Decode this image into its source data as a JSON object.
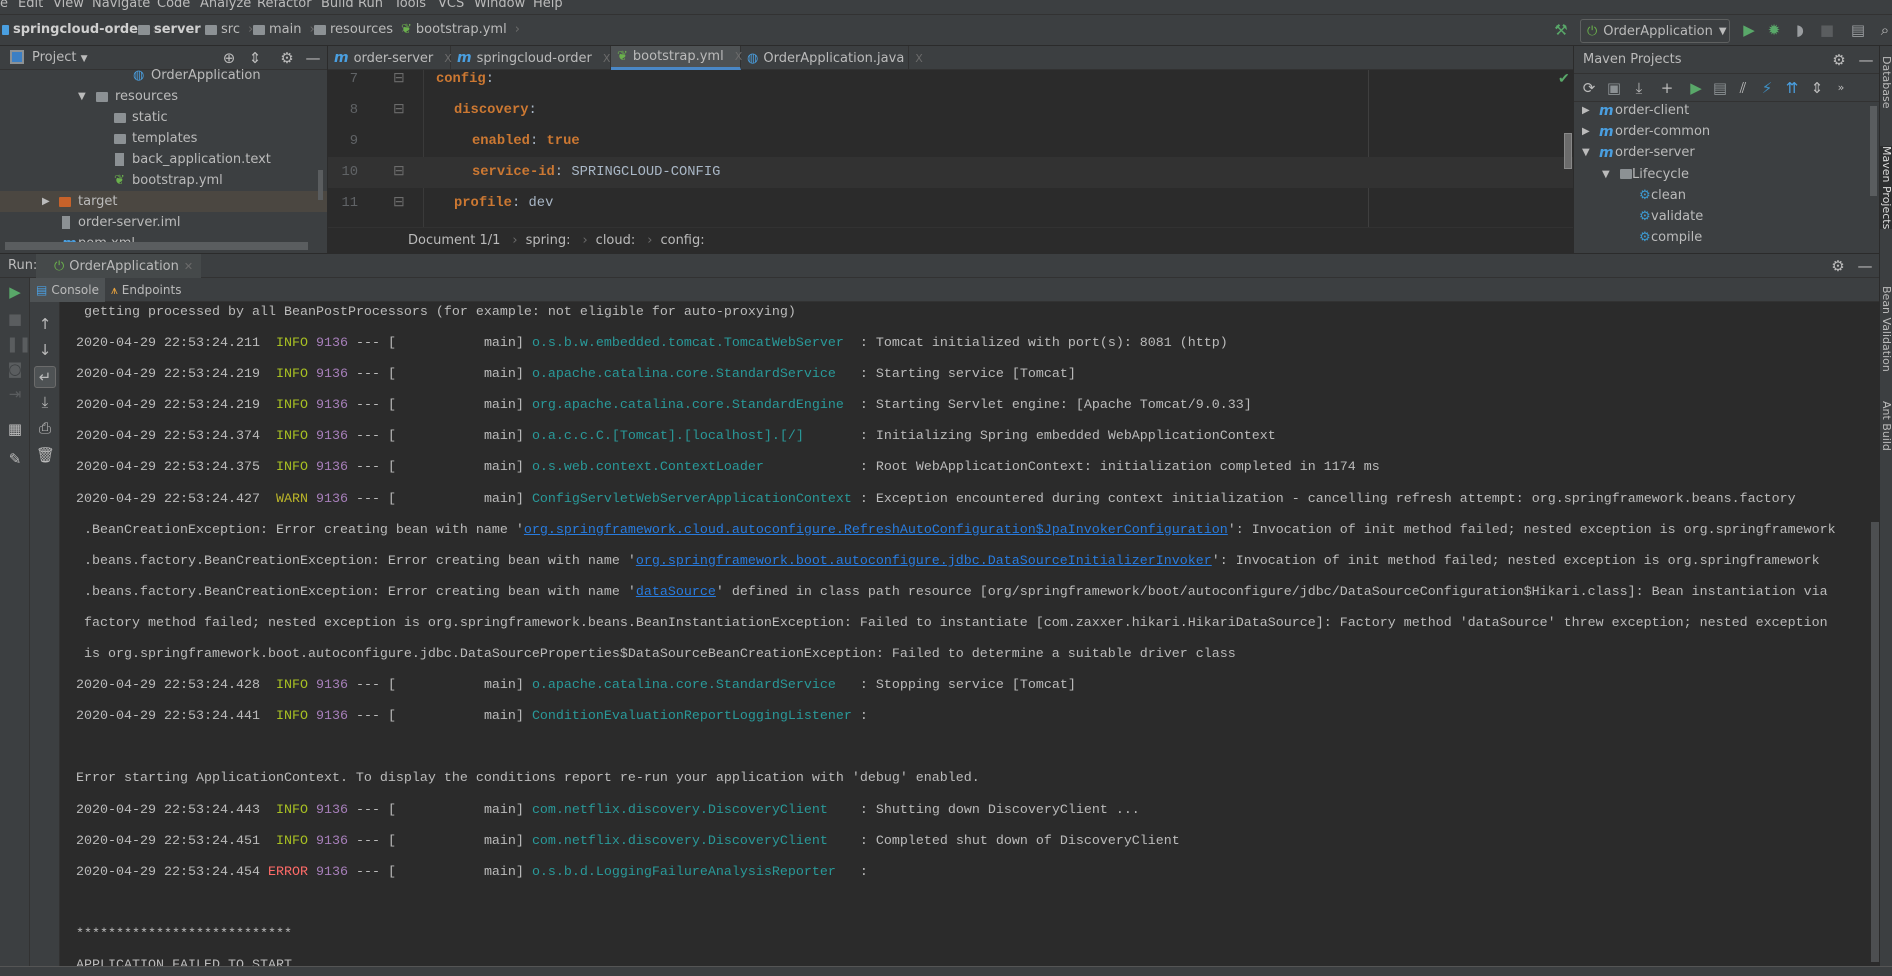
{
  "menu": [
    "e",
    "Edit",
    "View",
    "Navigate",
    "Code",
    "Analyze",
    "Refactor",
    "Build",
    "Run",
    "Tools",
    "VCS",
    "Window",
    "Help"
  ],
  "navbar": {
    "crumbs": [
      "springcloud-order",
      "server",
      "src",
      "main",
      "resources",
      "bootstrap.yml"
    ],
    "run_config": "OrderApplication"
  },
  "project": {
    "title": "Project",
    "tree": [
      {
        "label": "OrderApplication",
        "icon": "spring-boot-class-icon"
      },
      {
        "label": "resources",
        "icon": "resources-folder-icon",
        "expanded": true
      },
      {
        "label": "static",
        "icon": "folder-icon"
      },
      {
        "label": "templates",
        "icon": "folder-icon"
      },
      {
        "label": "back_application.text",
        "icon": "text-file-icon"
      },
      {
        "label": "bootstrap.yml",
        "icon": "spring-yml-icon"
      },
      {
        "label": "target",
        "icon": "excluded-folder-icon",
        "expanded": false
      },
      {
        "label": "order-server.iml",
        "icon": "iml-file-icon"
      },
      {
        "label": "pom.xml",
        "icon": "maven-icon"
      }
    ]
  },
  "editor": {
    "tabs": [
      {
        "label": "order-server",
        "icon": "maven-icon"
      },
      {
        "label": "springcloud-order",
        "icon": "maven-icon"
      },
      {
        "label": "bootstrap.yml",
        "icon": "spring-yml-icon",
        "active": true
      },
      {
        "label": "OrderApplication.java",
        "icon": "spring-boot-class-icon"
      }
    ],
    "lines": [
      {
        "num": "7",
        "key": "config",
        "value": ""
      },
      {
        "num": "8",
        "key": "discovery",
        "value": ""
      },
      {
        "num": "9",
        "key": "enabled",
        "value": "true",
        "bold_value": true
      },
      {
        "num": "10",
        "key": "service-id",
        "value": "SPRINGCLOUD-CONFIG",
        "current": true
      },
      {
        "num": "11",
        "key": "profile",
        "value": "dev"
      }
    ],
    "breadcrumb": [
      "Document 1/1",
      "spring:",
      "cloud:",
      "config:"
    ]
  },
  "maven": {
    "title": "Maven Projects",
    "tree": [
      {
        "label": "order-client",
        "level": 0,
        "expanded": false
      },
      {
        "label": "order-common",
        "level": 0,
        "expanded": false
      },
      {
        "label": "order-server",
        "level": 0,
        "expanded": true
      },
      {
        "label": "Lifecycle",
        "level": 1,
        "expanded": true
      },
      {
        "label": "clean",
        "level": 2
      },
      {
        "label": "validate",
        "level": 2
      },
      {
        "label": "compile",
        "level": 2
      }
    ]
  },
  "right_stripe": [
    "Database",
    "Maven Projects",
    "Bean Validation",
    "Ant Build"
  ],
  "run": {
    "label": "Run:",
    "tab": "OrderApplication",
    "console_tabs": [
      "Console",
      "Endpoints"
    ]
  },
  "colors": {
    "info": "#a8c023",
    "warn": "#bbb529",
    "error": "#ff6b68",
    "logger": "#299999",
    "link": "#287bde",
    "yaml_key": "#cc7832"
  },
  "console": [
    {
      "cont": [
        {
          "t": "getting processed by all BeanPostProcessors (for example: not eligible for auto-proxying)"
        }
      ]
    },
    {
      "ts": "2020-04-29 22:53:24.211",
      "level": "INFO",
      "pid": "9136",
      "thread": "main",
      "logger": "o.s.b.w.embedded.tomcat.TomcatWebServer",
      "msg": "Tomcat initialized with port(s): 8081 (http)"
    },
    {
      "ts": "2020-04-29 22:53:24.219",
      "level": "INFO",
      "pid": "9136",
      "thread": "main",
      "logger": "o.apache.catalina.core.StandardService",
      "msg": "Starting service [Tomcat]"
    },
    {
      "ts": "2020-04-29 22:53:24.219",
      "level": "INFO",
      "pid": "9136",
      "thread": "main",
      "logger": "org.apache.catalina.core.StandardEngine",
      "msg": "Starting Servlet engine: [Apache Tomcat/9.0.33]"
    },
    {
      "ts": "2020-04-29 22:53:24.374",
      "level": "INFO",
      "pid": "9136",
      "thread": "main",
      "logger": "o.a.c.c.C.[Tomcat].[localhost].[/]",
      "msg": "Initializing Spring embedded WebApplicationContext"
    },
    {
      "ts": "2020-04-29 22:53:24.375",
      "level": "INFO",
      "pid": "9136",
      "thread": "main",
      "logger": "o.s.web.context.ContextLoader",
      "msg": "Root WebApplicationContext: initialization completed in 1174 ms"
    },
    {
      "ts": "2020-04-29 22:53:24.427",
      "level": "WARN",
      "pid": "9136",
      "thread": "main",
      "logger": "ConfigServletWebServerApplicationContext",
      "msg": "Exception encountered during context initialization - cancelling refresh attempt: org.springframework.beans.factory"
    },
    {
      "cont": [
        {
          "t": ".BeanCreationException: Error creating bean with name '"
        },
        {
          "t": "org.springframework.cloud.autoconfigure.RefreshAutoConfiguration$JpaInvokerConfiguration",
          "link": true
        },
        {
          "t": "': Invocation of init method failed; nested exception is org.springframework"
        }
      ]
    },
    {
      "cont": [
        {
          "t": ".beans.factory.BeanCreationException: Error creating bean with name '"
        },
        {
          "t": "org.springframework.boot.autoconfigure.jdbc.DataSourceInitializerInvoker",
          "link": true
        },
        {
          "t": "': Invocation of init method failed; nested exception is org.springframework"
        }
      ]
    },
    {
      "cont": [
        {
          "t": ".beans.factory.BeanCreationException: Error creating bean with name '"
        },
        {
          "t": "dataSource",
          "link": true
        },
        {
          "t": "' defined in class path resource [org/springframework/boot/autoconfigure/jdbc/DataSourceConfiguration$Hikari.class]: Bean instantiation via"
        }
      ]
    },
    {
      "cont": [
        {
          "t": "factory method failed; nested exception is org.springframework.beans.BeanInstantiationException: Failed to instantiate [com.zaxxer.hikari.HikariDataSource]: Factory method 'dataSource' threw exception; nested exception"
        }
      ]
    },
    {
      "cont": [
        {
          "t": "is org.springframework.boot.autoconfigure.jdbc.DataSourceProperties$DataSourceBeanCreationException: Failed to determine a suitable driver class"
        }
      ]
    },
    {
      "ts": "2020-04-29 22:53:24.428",
      "level": "INFO",
      "pid": "9136",
      "thread": "main",
      "logger": "o.apache.catalina.core.StandardService",
      "msg": "Stopping service [Tomcat]"
    },
    {
      "ts": "2020-04-29 22:53:24.441",
      "level": "INFO",
      "pid": "9136",
      "thread": "main",
      "logger": "ConditionEvaluationReportLoggingListener",
      "msg": ""
    },
    {
      "plain": ""
    },
    {
      "plain": "Error starting ApplicationContext. To display the conditions report re-run your application with 'debug' enabled."
    },
    {
      "ts": "2020-04-29 22:53:24.443",
      "level": "INFO",
      "pid": "9136",
      "thread": "main",
      "logger": "com.netflix.discovery.DiscoveryClient",
      "msg": "Shutting down DiscoveryClient ..."
    },
    {
      "ts": "2020-04-29 22:53:24.451",
      "level": "INFO",
      "pid": "9136",
      "thread": "main",
      "logger": "com.netflix.discovery.DiscoveryClient",
      "msg": "Completed shut down of DiscoveryClient"
    },
    {
      "ts": "2020-04-29 22:53:24.454",
      "level": "ERROR",
      "pid": "9136",
      "thread": "main",
      "logger": "o.s.b.d.LoggingFailureAnalysisReporter",
      "msg": ""
    },
    {
      "plain": ""
    },
    {
      "plain": "***************************"
    },
    {
      "plain": "APPLICATION FAILED TO START"
    }
  ]
}
